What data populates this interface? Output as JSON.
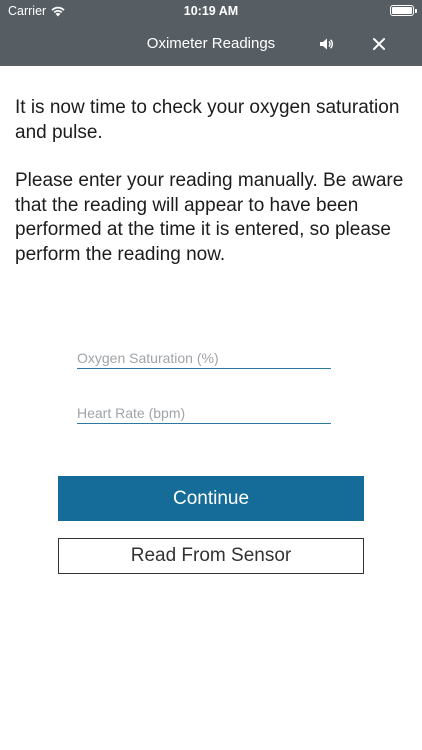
{
  "status_bar": {
    "carrier": "Carrier",
    "time": "10:19 AM",
    "wifi_icon": "wifi-icon",
    "battery_icon": "battery-icon"
  },
  "nav": {
    "title": "Oximeter Readings",
    "speaker_icon": "speaker-icon",
    "close_icon": "close-icon"
  },
  "instructions": {
    "paragraph1": "It is now time to check your oxygen saturation and pulse.",
    "paragraph2": "Please enter your reading manually. Be aware that the reading will appear to have been performed at the time it is entered, so please perform the reading now."
  },
  "form": {
    "oxygen_placeholder": "Oxygen Saturation (%)",
    "oxygen_value": "",
    "heart_rate_placeholder": "Heart Rate (bpm)",
    "heart_rate_value": ""
  },
  "buttons": {
    "continue_label": "Continue",
    "read_sensor_label": "Read From Sensor"
  },
  "colors": {
    "nav_background": "#575e63",
    "primary_button": "#156c98",
    "field_underline": "#2b7a9c"
  }
}
